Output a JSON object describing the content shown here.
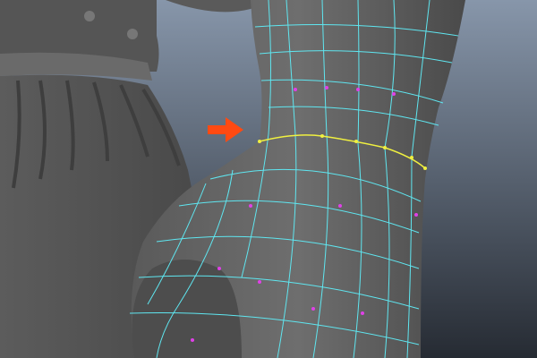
{
  "viewport": {
    "background_top": "#8796aa",
    "background_bottom": "#262b33",
    "mesh_color": "#6b6b6b",
    "wire_color": "#5fe6f0",
    "vertex_color": "#e040e8",
    "selected_edge_color": "#f0f040",
    "arrow_color": "#ff4a12",
    "arrow_icon": "arrow-right-icon"
  }
}
